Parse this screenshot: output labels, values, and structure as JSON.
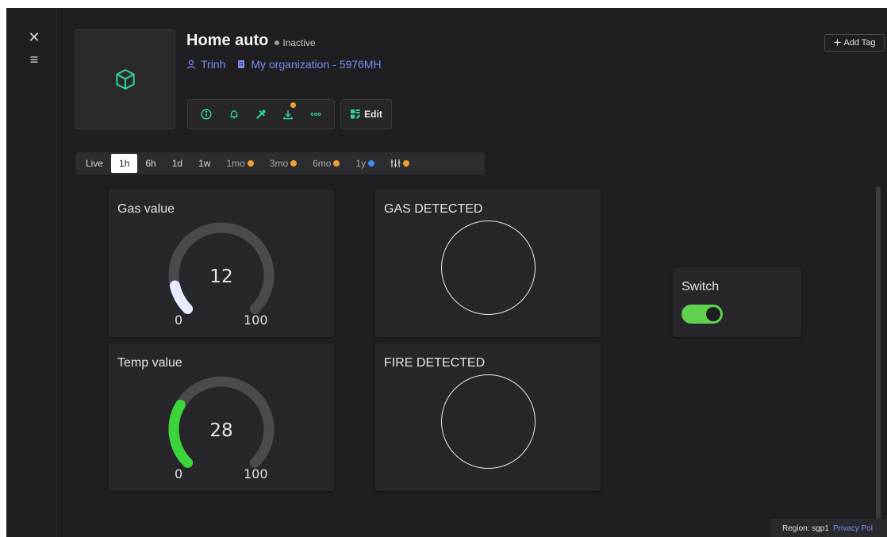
{
  "device": {
    "name": "Home auto",
    "status": "Inactive",
    "owner": "Trinh",
    "organization": "My organization - 5976MH"
  },
  "toolbar": {
    "icons": [
      "info-icon",
      "bell-icon",
      "tools-icon",
      "download-icon",
      "more-icon"
    ],
    "edit_label": "Edit"
  },
  "add_tag_label": "Add Tag",
  "timebar": {
    "items": [
      "Live",
      "1h",
      "6h",
      "1d",
      "1w",
      "1mo",
      "3mo",
      "6mo",
      "1y"
    ],
    "selected": "1h"
  },
  "widgets": {
    "gas": {
      "title": "Gas value",
      "value": 12,
      "min": 0,
      "max": 100,
      "color": "#e8ecff"
    },
    "temp": {
      "title": "Temp value",
      "value": 28,
      "min": 0,
      "max": 100,
      "color": "#3bd43b"
    },
    "gas_led": {
      "title": "GAS DETECTED"
    },
    "fire_led": {
      "title": "FIRE DETECTED"
    },
    "switch": {
      "title": "Switch",
      "state": "on"
    }
  },
  "footer": {
    "region": "Region: sgp1",
    "privacy": "Privacy Pol"
  },
  "colors": {
    "background": "#1f1f22",
    "card": "#27272b",
    "accent_link": "#7c8cf0",
    "brand_icon": "#2fd6a0",
    "pro_badge": "#f0a030",
    "switch_on": "#5fd14e"
  }
}
